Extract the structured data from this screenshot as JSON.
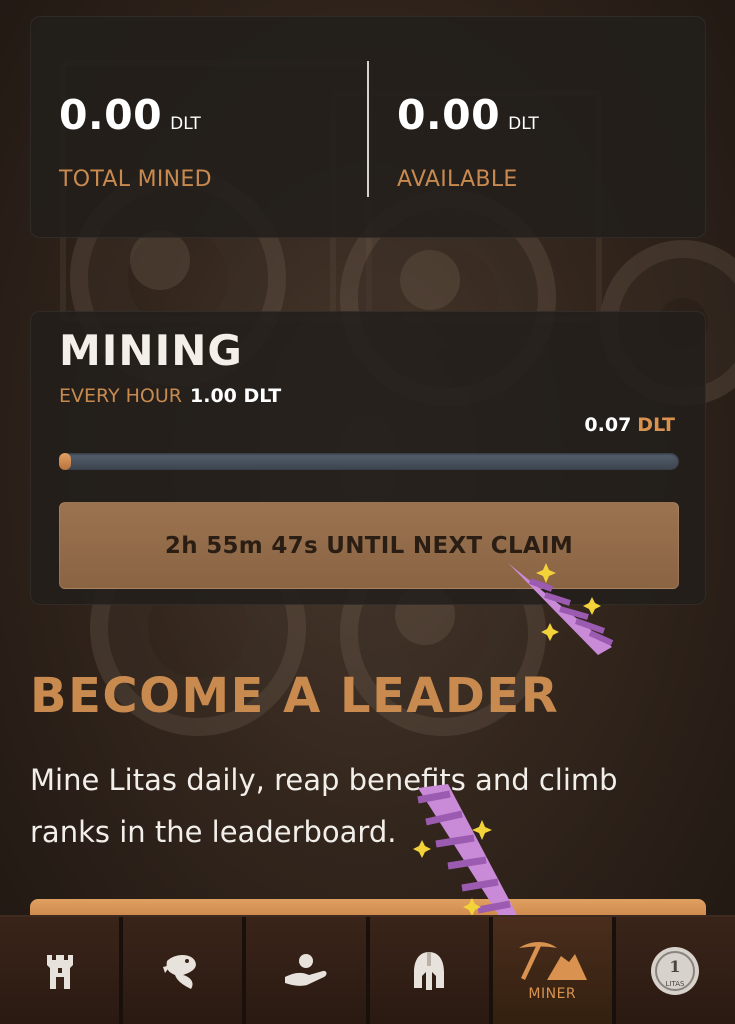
{
  "stats": {
    "total_mined": {
      "value": "0.00",
      "unit": "DLT",
      "label": "TOTAL MINED"
    },
    "available": {
      "value": "0.00",
      "unit": "DLT",
      "label": "AVAILABLE"
    }
  },
  "mining": {
    "title": "MINING",
    "rate_label": "EVERY HOUR",
    "rate_value": "1.00 DLT",
    "progress_value": "0.07",
    "progress_unit": "DLT",
    "progress_fraction": 0.02,
    "claim_button": "2h 55m 47s UNTIL NEXT CLAIM"
  },
  "leader": {
    "title": "BECOME A LEADER",
    "description": "Mine Litas daily, reap benefits and climb ranks in the leaderboard."
  },
  "nav": {
    "items": [
      {
        "icon": "castle-tower-icon",
        "label": ""
      },
      {
        "icon": "dragon-icon",
        "label": ""
      },
      {
        "icon": "hand-offering-icon",
        "label": ""
      },
      {
        "icon": "spartan-helmet-icon",
        "label": ""
      },
      {
        "icon": "pickaxe-mine-icon",
        "label": "MINER",
        "active": true
      },
      {
        "icon": "litas-coin-icon",
        "label": "",
        "coin_text": "LITAS"
      }
    ]
  },
  "colors": {
    "accent": "#c98a4f",
    "card_bg": "#221e1b",
    "claim_button": "#8f6a48",
    "progress_track": "#4a525e",
    "drill": "#c98ad8",
    "nav_bg": "#2a1a12"
  }
}
